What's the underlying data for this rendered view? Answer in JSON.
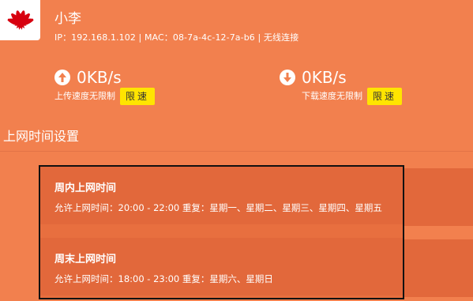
{
  "device": {
    "name": "小李",
    "info": "IP：192.168.1.102 | MAC：08-7a-4c-12-7a-b6 | 无线连接"
  },
  "upload": {
    "speed": "0KB/s",
    "caption": "上传速度无限制",
    "limit_label": "限速",
    "icon": "arrow-up-circle-icon"
  },
  "download": {
    "speed": "0KB/s",
    "caption": "下载速度无限制",
    "limit_label": "限速",
    "icon": "arrow-down-circle-icon"
  },
  "section": {
    "title": "上网时间设置"
  },
  "schedules": [
    {
      "title": "周内上网时间",
      "detail": "允许上网时间：20:00 - 22:00   重复：星期一、星期二、星期三、星期四、星期五"
    },
    {
      "title": "周末上网时间",
      "detail": "允许上网时间：18:00 - 23:00   重复：星期六、星期日"
    }
  ],
  "colors": {
    "background": "#f2804e",
    "item_background": "#e2683b",
    "limit_button": "#ffe400",
    "logo_red": "#d7000f"
  }
}
